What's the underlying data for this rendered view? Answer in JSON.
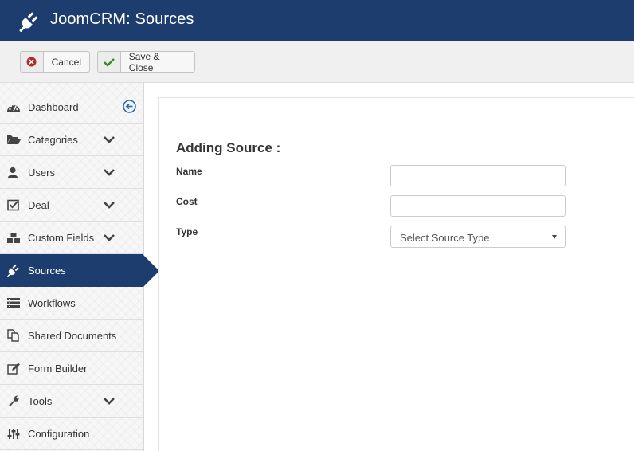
{
  "header": {
    "title": "JoomCRM: Sources",
    "bg_color": "#1c3d6e",
    "icon": "plug-icon"
  },
  "toolbar": {
    "cancel_label": "Cancel",
    "cancel_icon": "cancel-circle-icon",
    "save_close_label": "Save & Close",
    "save_close_icon": "checkmark-icon"
  },
  "sidebar": {
    "active_color": "#1c3d6e",
    "items": [
      {
        "label": "Dashboard",
        "icon": "dashboard-icon",
        "chevron": false
      },
      {
        "label": "Categories",
        "icon": "folder-open-icon",
        "chevron": true
      },
      {
        "label": "Users",
        "icon": "user-icon",
        "chevron": true
      },
      {
        "label": "Deal",
        "icon": "checkbox-icon",
        "chevron": true
      },
      {
        "label": "Custom Fields",
        "icon": "cubes-icon",
        "chevron": true
      },
      {
        "label": "Sources",
        "icon": "plug-icon",
        "chevron": false,
        "active": true
      },
      {
        "label": "Workflows",
        "icon": "server-icon",
        "chevron": false
      },
      {
        "label": "Shared Documents",
        "icon": "documents-icon",
        "chevron": false
      },
      {
        "label": "Form Builder",
        "icon": "edit-icon",
        "chevron": false
      },
      {
        "label": "Tools",
        "icon": "wrench-icon",
        "chevron": true
      },
      {
        "label": "Configuration",
        "icon": "sliders-icon",
        "chevron": false
      }
    ]
  },
  "form": {
    "heading": "Adding Source :",
    "name_label": "Name",
    "name_value": "",
    "cost_label": "Cost",
    "cost_value": "",
    "type_label": "Type",
    "type_selected": "Select Source Type"
  }
}
